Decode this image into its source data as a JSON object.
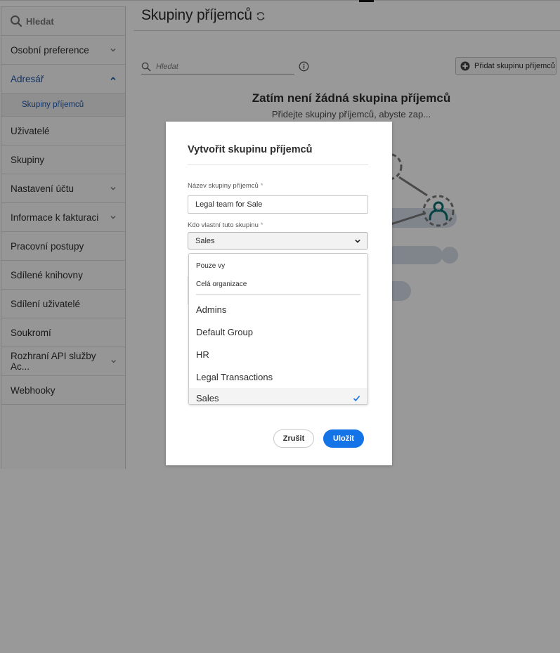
{
  "sidebar": {
    "search_placeholder": "Hledat",
    "items": [
      {
        "label": "Osobní preference",
        "has_chevron": true,
        "expanded": false
      },
      {
        "label": "Adresář",
        "has_chevron": true,
        "expanded": true,
        "active": true
      },
      {
        "label": "Uživatelé"
      },
      {
        "label": "Skupiny"
      },
      {
        "label": "Nastavení účtu",
        "has_chevron": true
      },
      {
        "label": "Informace k fakturaci",
        "has_chevron": true
      },
      {
        "label": "Pracovní postupy"
      },
      {
        "label": "Sdílené knihovny"
      },
      {
        "label": "Sdílení uživatelé"
      },
      {
        "label": "Soukromí"
      },
      {
        "label": "Rozhraní API služby Ac...",
        "has_chevron": true
      },
      {
        "label": "Webhooky"
      }
    ],
    "subitems": {
      "adresar": [
        {
          "label": "Skupiny příjemců",
          "active": true
        }
      ]
    }
  },
  "main": {
    "title": "Skupiny příjemců",
    "search_placeholder": "Hledat",
    "add_button_label": "Přidat skupinu příjemců",
    "empty_state": {
      "title": "Zatím není žádná skupina příjemců",
      "subtitle": "Přidejte skupiny příjemců, abyste zap..."
    }
  },
  "dialog": {
    "title": "Vytvořit skupinu příjemců",
    "name_label": "Název skupiny příjemců",
    "name_value": "Legal team for Sale",
    "owner_label": "Kdo vlastní tuto skupinu",
    "required_mark": "*",
    "owner_selected": "Sales",
    "cancel_label": "Zrušit",
    "save_label": "Uložit"
  },
  "dropdown": {
    "scope_options": [
      "Pouze vy",
      "Celá organizace"
    ],
    "group_options": [
      "Admins",
      "Default Group",
      "HR",
      "Legal Transactions",
      "Sales"
    ],
    "selected": "Sales"
  },
  "colors": {
    "accent": "#1473e6",
    "link_active": "#1f57a8",
    "teal_icon": "#0d6e6e",
    "overlay": "rgba(0,0,0,0.40)"
  }
}
